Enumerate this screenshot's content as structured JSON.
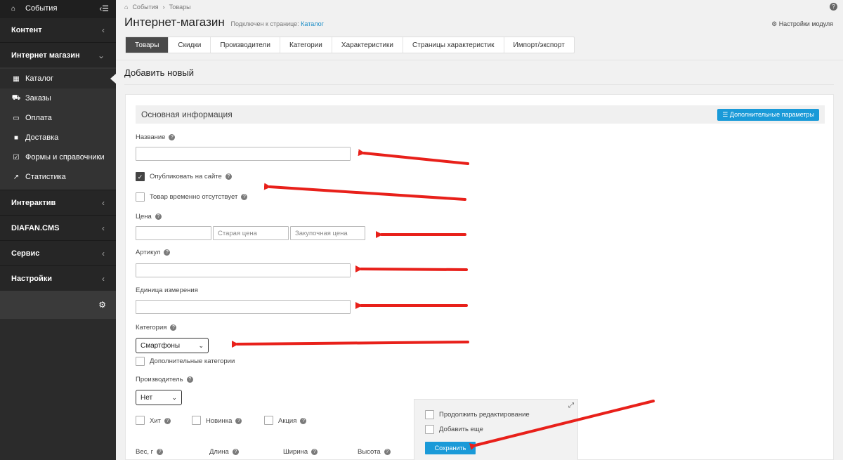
{
  "sidebar": {
    "top_label": "События",
    "sections": [
      {
        "label": "Контент"
      },
      {
        "label": "Интернет магазин"
      }
    ],
    "shop_items": [
      {
        "label": "Каталог",
        "icon": "grid-icon"
      },
      {
        "label": "Заказы",
        "icon": "cart-icon"
      },
      {
        "label": "Оплата",
        "icon": "card-icon"
      },
      {
        "label": "Доставка",
        "icon": "truck-icon"
      },
      {
        "label": "Формы и справочники",
        "icon": "checkbox-icon"
      },
      {
        "label": "Статистика",
        "icon": "chart-icon"
      }
    ],
    "sections2": [
      {
        "label": "Интерактив"
      },
      {
        "label": "DIAFAN.CMS"
      },
      {
        "label": "Сервис"
      },
      {
        "label": "Настройки"
      }
    ]
  },
  "breadcrumb": {
    "item1": "События",
    "item2": "Товары"
  },
  "page": {
    "title": "Интернет-магазин",
    "connected_prefix": "Подключен к странице:",
    "connected_link": "Каталог",
    "module_settings": "Настройки модуля",
    "add_new": "Добавить новый"
  },
  "tabs": [
    "Товары",
    "Скидки",
    "Производители",
    "Категории",
    "Характеристики",
    "Страницы характеристик",
    "Импорт/экспорт"
  ],
  "form": {
    "section_title": "Основная информация",
    "extra_params": "Дополнительные параметры",
    "name_label": "Название",
    "publish_label": "Опубликовать на сайте",
    "absent_label": "Товар временно отсутствует",
    "price_label": "Цена",
    "old_price_placeholder": "Старая цена",
    "purchase_price_placeholder": "Закупочная цена",
    "article_label": "Артикул",
    "unit_label": "Единица измерения",
    "category_label": "Категория",
    "category_value": "Смартфоны",
    "extra_categories_label": "Дополнительные категории",
    "manufacturer_label": "Производитель",
    "manufacturer_value": "Нет",
    "hit_label": "Хит",
    "new_label": "Новинка",
    "promo_label": "Акция",
    "weight_label": "Вес, г",
    "length_label": "Длина",
    "width_label": "Ширина",
    "height_label": "Высота"
  },
  "savebox": {
    "continue_label": "Продолжить редактирование",
    "add_more_label": "Добавить еще",
    "save_label": "Сохранить"
  },
  "colors": {
    "accent": "#1a9ad8",
    "arrow": "#e8201a",
    "sidebar": "#2b2b2b"
  }
}
